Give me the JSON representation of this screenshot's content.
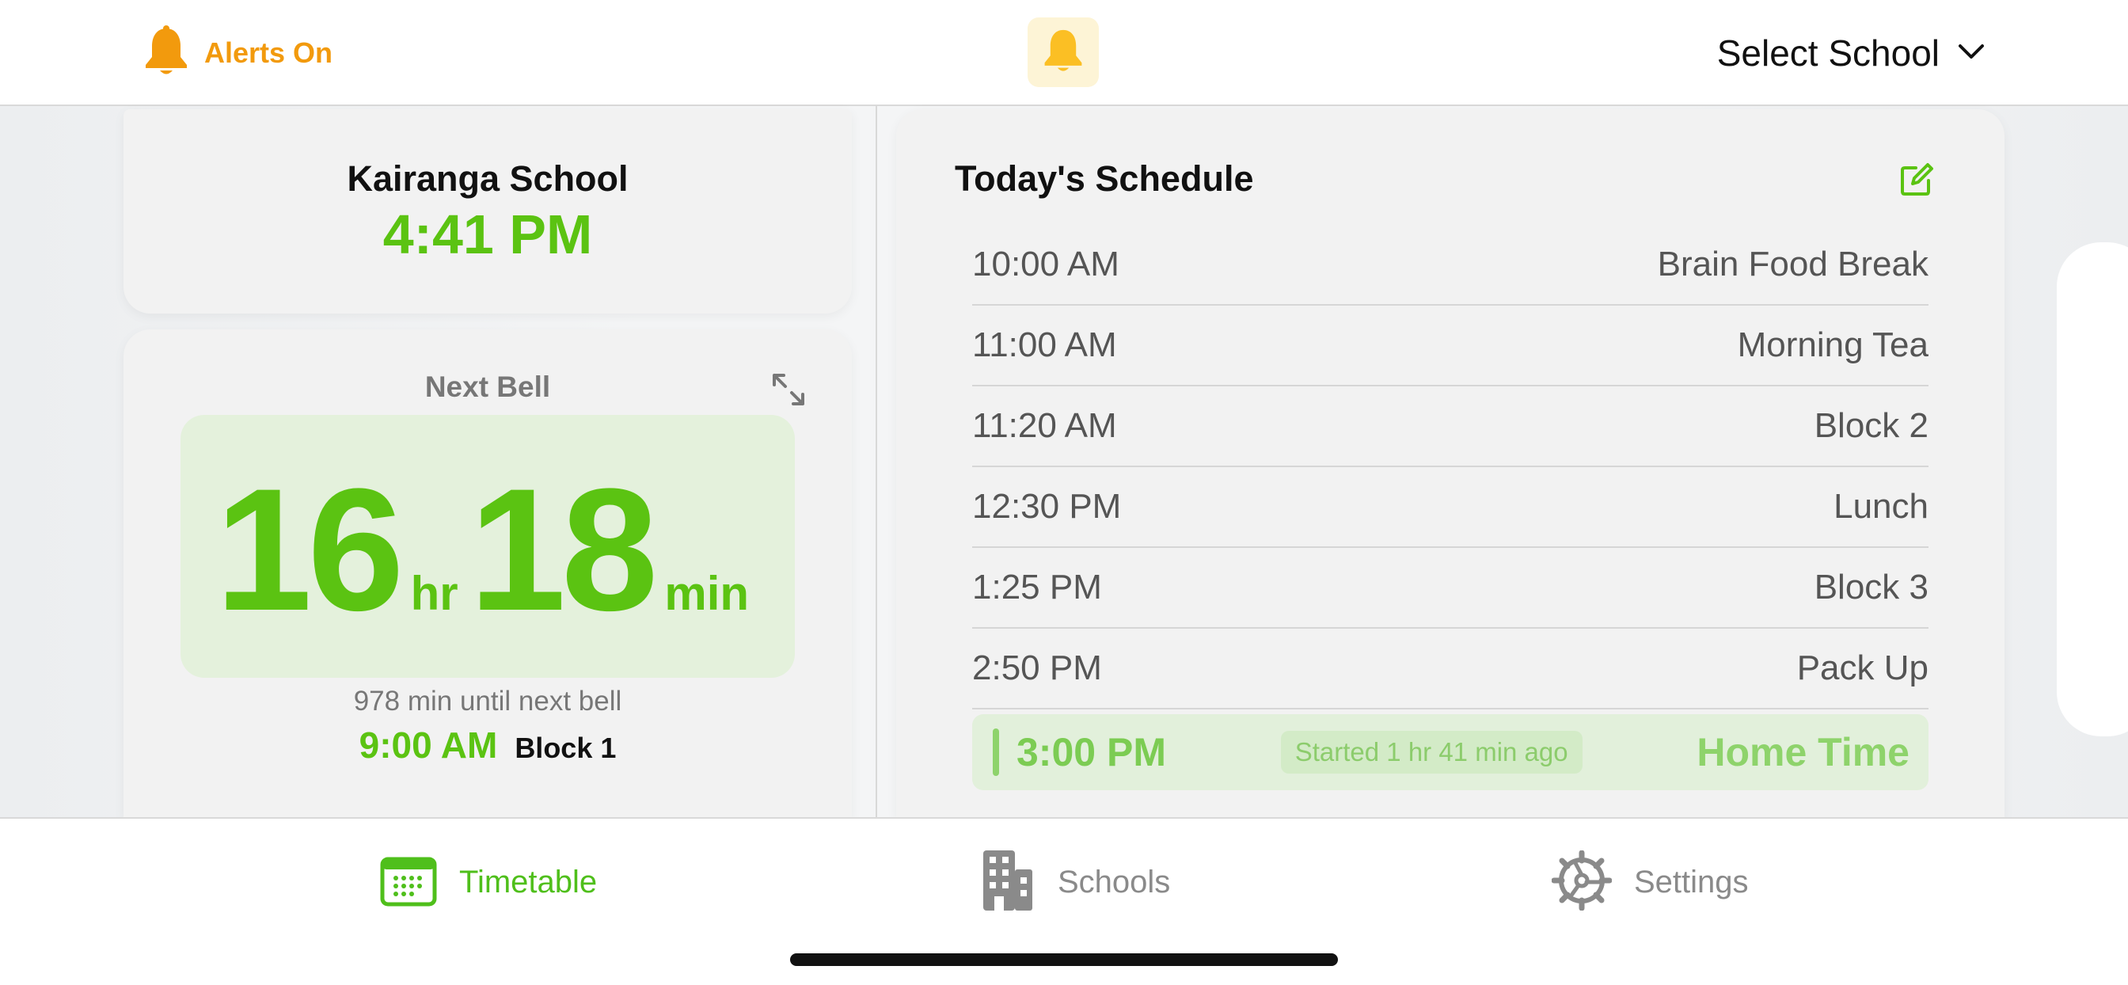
{
  "header": {
    "alerts_label": "Alerts On",
    "alerts_icon": "bell-icon",
    "center_icon": "bell-icon",
    "select_school_label": "Select School",
    "accent_orange": "#f29a0d",
    "accent_yellow": "#fbbf24"
  },
  "school_card": {
    "name": "Kairanga School",
    "time": "4:41 PM"
  },
  "next_bell": {
    "label": "Next Bell",
    "hours": "16",
    "hours_unit": "hr",
    "minutes": "18",
    "minutes_unit": "min",
    "until_text": "978 min until next bell",
    "bell_time": "9:00 AM",
    "bell_name": "Block 1"
  },
  "schedule": {
    "title": "Today's Schedule",
    "items": [
      {
        "time": "10:00 AM",
        "name": "Brain Food Break"
      },
      {
        "time": "11:00 AM",
        "name": "Morning Tea"
      },
      {
        "time": "11:20 AM",
        "name": "Block 2"
      },
      {
        "time": "12:30 PM",
        "name": "Lunch"
      },
      {
        "time": "1:25 PM",
        "name": "Block 3"
      },
      {
        "time": "2:50 PM",
        "name": "Pack Up"
      }
    ],
    "current": {
      "time": "3:00 PM",
      "status": "Started 1 hr 41 min ago",
      "name": "Home Time"
    }
  },
  "tabs": {
    "timetable": "Timetable",
    "schools": "Schools",
    "settings": "Settings"
  },
  "colors": {
    "accent_green": "#5bc312",
    "countdown_bg": "#e4f1dc"
  }
}
